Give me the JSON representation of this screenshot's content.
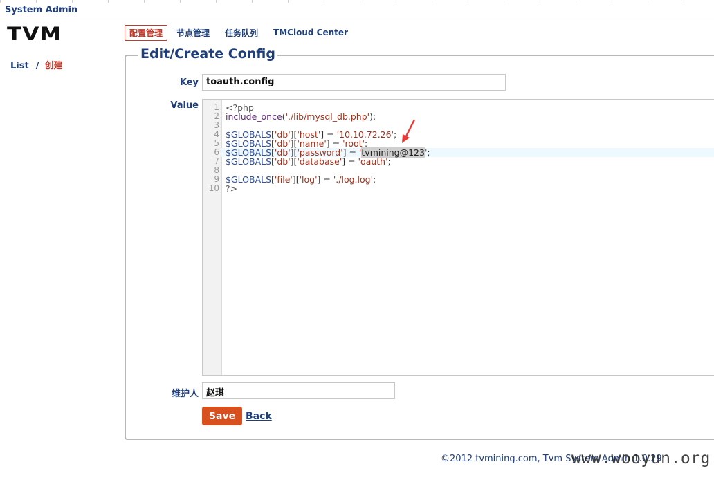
{
  "app": {
    "title": "System Admin",
    "logo": "TVM"
  },
  "nav": {
    "items": [
      {
        "label": "配置管理",
        "active": true
      },
      {
        "label": "节点管理",
        "active": false
      },
      {
        "label": "任务队列",
        "active": false
      },
      {
        "label": "TMCloud Center",
        "active": false
      }
    ]
  },
  "breadcrumb": {
    "list": "List",
    "separator": "/",
    "current": "创建"
  },
  "form": {
    "legend": "Edit/Create Config",
    "key_label": "Key",
    "key_value": "toauth.config",
    "value_label": "Value",
    "maintainer_label": "维护人",
    "maintainer_value": "赵琪",
    "save_label": "Save",
    "back_label": "Back"
  },
  "editor": {
    "line_numbers": [
      "1",
      "2",
      "3",
      "4",
      "5",
      "6",
      "7",
      "8",
      "9",
      "10"
    ],
    "lines": {
      "l1": "<?php",
      "l2a": "include_once",
      "l2b": "(",
      "l2c": "'./lib/mysql_db.php'",
      "l2d": ");",
      "l4a": "$GLOBALS",
      "l4b": "[",
      "l4c": "'db'",
      "l4d": "][",
      "l4e": "'host'",
      "l4f": "] = ",
      "l4g": "'10.10.72.26'",
      "l4h": ";",
      "l5a": "$GLOBALS",
      "l5b": "[",
      "l5c": "'db'",
      "l5d": "][",
      "l5e": "'name'",
      "l5f": "] = ",
      "l5g": "'root'",
      "l5h": ";",
      "l6a": "$GLOBALS",
      "l6b": "[",
      "l6c": "'db'",
      "l6d": "][",
      "l6e": "'password'",
      "l6f": "] = ",
      "l6g": "'",
      "l6sel": "tvmining@123",
      "l6h": "'",
      "l6i": ";",
      "l7a": "$GLOBALS",
      "l7b": "[",
      "l7c": "'db'",
      "l7d": "][",
      "l7e": "'database'",
      "l7f": "] = ",
      "l7g": "'oauth'",
      "l7h": ";",
      "l9a": "$GLOBALS",
      "l9b": "[",
      "l9c": "'file'",
      "l9d": "][",
      "l9e": "'log'",
      "l9f": "] = ",
      "l9g": "'./log.log'",
      "l9h": ";",
      "l10": "?>"
    }
  },
  "footer": {
    "text": "©2012 tvmining.com, Tvm System Admin 1.0.29"
  },
  "watermark": "www.wooyun.org",
  "colors": {
    "primary": "#1f3f7a",
    "accent": "#d9501f",
    "active": "#c0392b"
  }
}
